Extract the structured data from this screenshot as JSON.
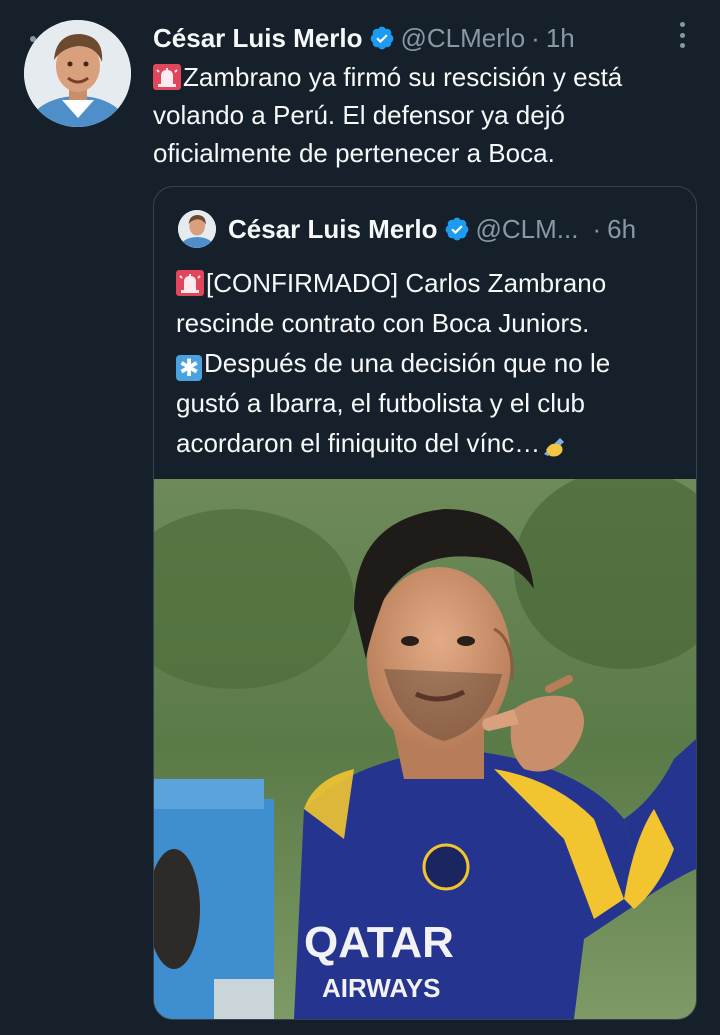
{
  "tweet": {
    "author_name": "César Luis Merlo",
    "handle": "@CLMerlo",
    "separator": "·",
    "time": "1h",
    "text": "Zambrano ya firmó su rescisión y está volando a Perú. El defensor ya dejó oficialmente de pertenecer a Boca."
  },
  "quoted_tweet": {
    "author_name": "César Luis Merlo",
    "handle": "@CLM...",
    "separator": "·",
    "time": "6h",
    "line1": "[CONFIRMADO] Carlos Zambrano rescinde contrato con Boca Juniors.",
    "line2": "Después de una decisión que no le gustó a Ibarra, el futbolista y el club acordaron el finiquito del vínc…",
    "media_shirt_text_1": "QATAR",
    "media_shirt_text_2": "AIRWAYS"
  },
  "icons": [
    "verified-badge-icon",
    "more-options-icon",
    "siren-emoji-icon",
    "asterisk-emoji-icon",
    "writing-hand-emoji-icon"
  ],
  "colors": {
    "background": "#15202b",
    "text": "#f7f9f9",
    "secondary_text": "#8899a6",
    "border": "#38444d",
    "verified_blue": "#1d9bf0"
  }
}
